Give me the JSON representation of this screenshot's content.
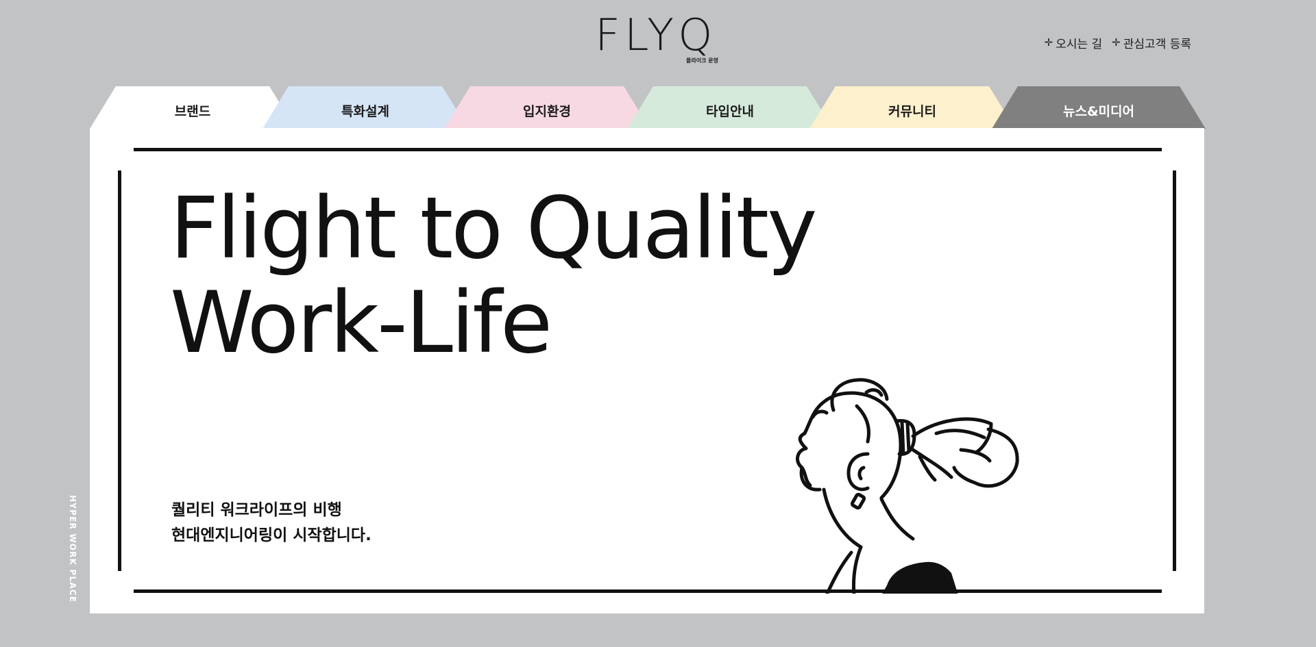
{
  "header": {
    "logo_text": "FLYQ",
    "logo_sub": "플라이크 운영",
    "links": [
      {
        "icon": "plus-icon",
        "label": "오시는 길"
      },
      {
        "icon": "plus-icon",
        "label": "관심고객 등록"
      }
    ]
  },
  "tabs": [
    {
      "label": "브랜드",
      "color": "#ffffff",
      "text_color": "#1b1b1b",
      "active": true
    },
    {
      "label": "특화설계",
      "color": "#d5e5f6",
      "text_color": "#1b1b1b"
    },
    {
      "label": "입지환경",
      "color": "#f7d9e3",
      "text_color": "#1b1b1b"
    },
    {
      "label": "타입안내",
      "color": "#d5eadb",
      "text_color": "#1b1b1b"
    },
    {
      "label": "커뮤니티",
      "color": "#fdf0cc",
      "text_color": "#1b1b1b"
    },
    {
      "label": "뉴스&미디어",
      "color": "#808080",
      "text_color": "#ffffff"
    }
  ],
  "hero": {
    "headline_line1": "Flight to Quality",
    "headline_line2": "Work-Life",
    "sub_line1": "퀄리티 워크라이프의 비행",
    "sub_line2": "현대엔지니어링이 시작합니다.",
    "illustration": "woman-line-drawing"
  },
  "side_label": "HYPER WORK PLACE",
  "colors": {
    "background": "#c2c3c5",
    "card": "#ffffff",
    "ink": "#111111"
  }
}
